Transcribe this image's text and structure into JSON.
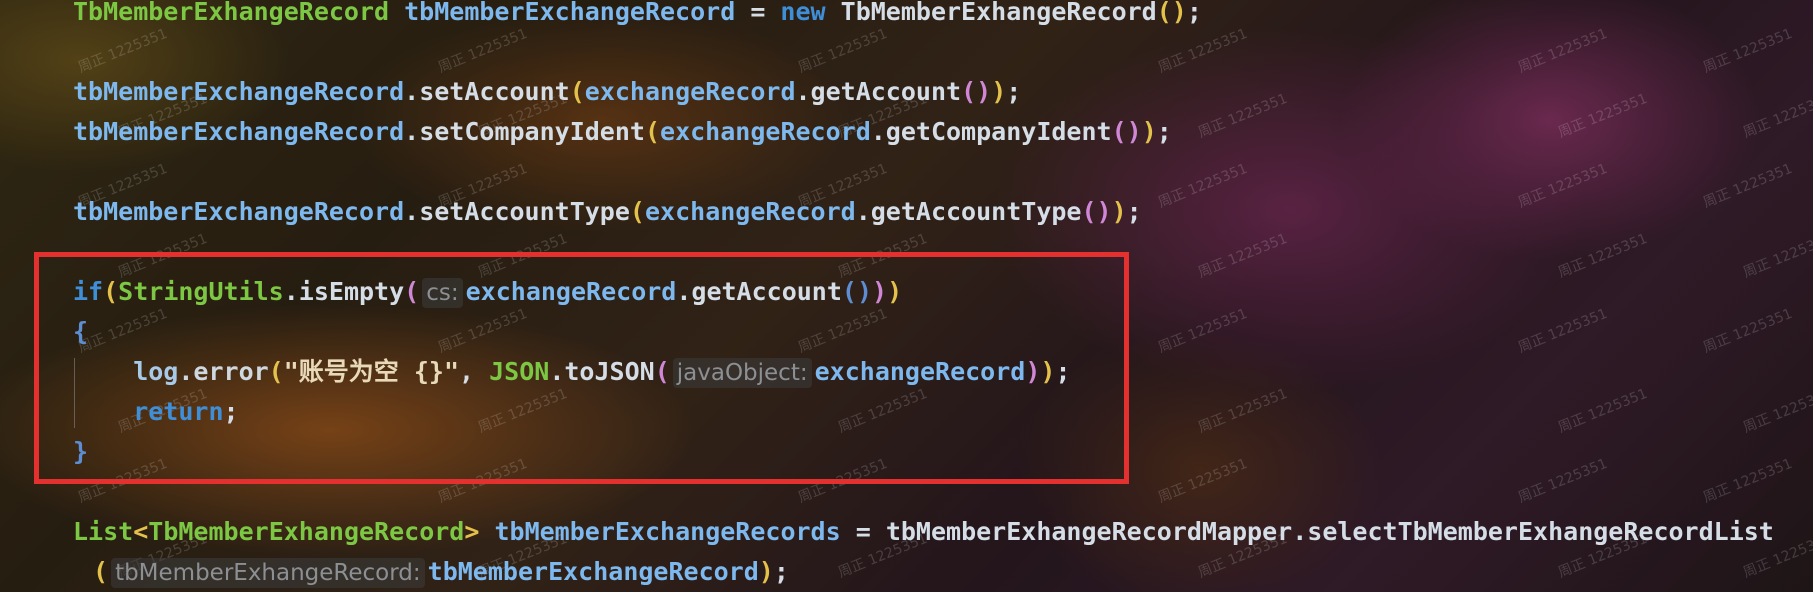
{
  "code_lines": [
    {
      "id": "l1",
      "tokens": [
        {
          "t": "TbMemberExhangeRecord",
          "c": "type"
        },
        {
          "t": " tbMemberExchangeRecord ",
          "c": "var"
        },
        {
          "t": "= ",
          "c": "plain"
        },
        {
          "t": "new ",
          "c": "kw"
        },
        {
          "t": "TbMemberExhangeRecord",
          "c": "plain"
        },
        {
          "t": "()",
          "c": "paren"
        },
        {
          "t": ";",
          "c": "plain"
        }
      ]
    },
    {
      "id": "l2",
      "tokens": [
        {
          "t": "tbMemberExchangeRecord",
          "c": "var"
        },
        {
          "t": ".setAccount",
          "c": "plain"
        },
        {
          "t": "(",
          "c": "paren"
        },
        {
          "t": "exchangeRecord",
          "c": "var"
        },
        {
          "t": ".getAccount",
          "c": "plain"
        },
        {
          "t": "()",
          "c": "paren2"
        },
        {
          "t": ")",
          "c": "paren"
        },
        {
          "t": ";",
          "c": "plain"
        }
      ]
    },
    {
      "id": "l3",
      "tokens": [
        {
          "t": "tbMemberExchangeRecord",
          "c": "var"
        },
        {
          "t": ".setCompanyIdent",
          "c": "plain"
        },
        {
          "t": "(",
          "c": "paren"
        },
        {
          "t": "exchangeRecord",
          "c": "var"
        },
        {
          "t": ".getCompanyIdent",
          "c": "plain"
        },
        {
          "t": "()",
          "c": "paren2"
        },
        {
          "t": ")",
          "c": "paren"
        },
        {
          "t": ";",
          "c": "plain"
        }
      ]
    },
    {
      "id": "l4",
      "tokens": [
        {
          "t": "tbMemberExchangeRecord",
          "c": "var"
        },
        {
          "t": ".setAccountType",
          "c": "plain"
        },
        {
          "t": "(",
          "c": "paren"
        },
        {
          "t": "exchangeRecord",
          "c": "var"
        },
        {
          "t": ".getAccountType",
          "c": "plain"
        },
        {
          "t": "()",
          "c": "paren2"
        },
        {
          "t": ")",
          "c": "paren"
        },
        {
          "t": ";",
          "c": "plain"
        }
      ]
    },
    {
      "id": "l5",
      "tokens": [
        {
          "t": "if",
          "c": "kw"
        },
        {
          "t": "(",
          "c": "paren"
        },
        {
          "t": "StringUtils",
          "c": "type"
        },
        {
          "t": ".isEmpty",
          "c": "plain"
        },
        {
          "t": "(",
          "c": "paren2"
        },
        {
          "t": "cs:",
          "c": "hint"
        },
        {
          "t": "exchangeRecord",
          "c": "var"
        },
        {
          "t": ".getAccount",
          "c": "plain"
        },
        {
          "t": "()",
          "c": "brace"
        },
        {
          "t": ")",
          "c": "paren2"
        },
        {
          "t": ")",
          "c": "paren"
        }
      ]
    },
    {
      "id": "l6",
      "tokens": [
        {
          "t": "{",
          "c": "brace"
        }
      ]
    },
    {
      "id": "l7",
      "tokens": [
        {
          "t": "    log",
          "c": "log"
        },
        {
          "t": ".error",
          "c": "err"
        },
        {
          "t": "(",
          "c": "paren"
        },
        {
          "t": "\"账号为空 {}\"",
          "c": "str"
        },
        {
          "t": ", ",
          "c": "plain"
        },
        {
          "t": "JSON",
          "c": "type"
        },
        {
          "t": ".toJSON",
          "c": "plain"
        },
        {
          "t": "(",
          "c": "paren2"
        },
        {
          "t": "javaObject:",
          "c": "hint"
        },
        {
          "t": "exchangeRecord",
          "c": "var"
        },
        {
          "t": ")",
          "c": "paren2"
        },
        {
          "t": ")",
          "c": "paren"
        },
        {
          "t": ";",
          "c": "plain"
        }
      ]
    },
    {
      "id": "l8",
      "tokens": [
        {
          "t": "    return",
          "c": "kw"
        },
        {
          "t": ";",
          "c": "plain"
        }
      ]
    },
    {
      "id": "l9",
      "tokens": [
        {
          "t": "}",
          "c": "brace"
        }
      ]
    },
    {
      "id": "l10",
      "tokens": [
        {
          "t": "List",
          "c": "type"
        },
        {
          "t": "<",
          "c": "paren"
        },
        {
          "t": "TbMemberExhangeRecord",
          "c": "type"
        },
        {
          "t": ">",
          "c": "paren"
        },
        {
          "t": " tbMemberExchangeRecords ",
          "c": "var"
        },
        {
          "t": "= tbMemberExhangeRecordMapper",
          "c": "plain"
        },
        {
          "t": ".selectTbMemberExhangeRecordList",
          "c": "plain"
        }
      ]
    },
    {
      "id": "l11",
      "tokens": [
        {
          "t": "(",
          "c": "paren"
        },
        {
          "t": "tbMemberExhangeRecord:",
          "c": "hint"
        },
        {
          "t": "tbMemberExchangeRecord",
          "c": "var"
        },
        {
          "t": ")",
          "c": "paren"
        },
        {
          "t": ";",
          "c": "plain"
        }
      ]
    }
  ],
  "watermark_text": "周正 1225351"
}
